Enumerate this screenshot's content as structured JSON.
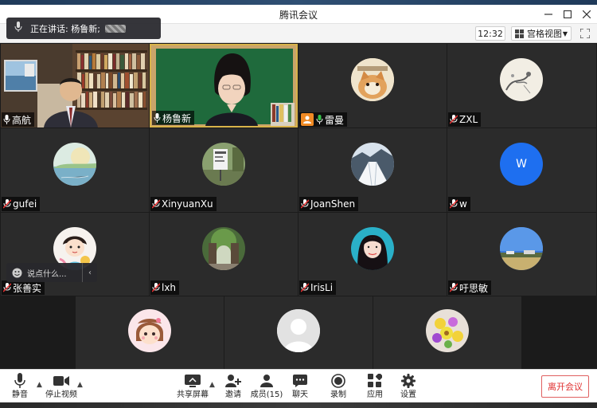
{
  "window": {
    "title": "腾讯会议"
  },
  "toolbar": {
    "clock": "12:32",
    "view_label": "宫格视图"
  },
  "speaking": {
    "label": "正在讲话: 杨鲁新;"
  },
  "participants": [
    {
      "name": "高航",
      "kind": "video-bookshelf"
    },
    {
      "name": "杨鲁新",
      "kind": "video-board"
    },
    {
      "name": "雷曼",
      "kind": "avatar-cat",
      "host": true
    },
    {
      "name": "ZXL",
      "kind": "avatar-ink"
    },
    {
      "name": "gufei",
      "kind": "avatar-paint"
    },
    {
      "name": "XinyuanXu",
      "kind": "avatar-sign"
    },
    {
      "name": "JoanShen",
      "kind": "avatar-snow"
    },
    {
      "name": "w",
      "kind": "avatar-letter",
      "letter": "W"
    },
    {
      "name": "张善实",
      "kind": "avatar-cartoon"
    },
    {
      "name": "lxh",
      "kind": "avatar-arch"
    },
    {
      "name": "IrisLi",
      "kind": "avatar-girl"
    },
    {
      "name": "吁思敏",
      "kind": "avatar-sky"
    },
    {
      "name": "",
      "kind": "avatar-doll"
    },
    {
      "name": "",
      "kind": "avatar-default"
    },
    {
      "name": "",
      "kind": "avatar-flower"
    }
  ],
  "chat": {
    "placeholder": "说点什么..."
  },
  "bottom": {
    "mute": "静音",
    "stop_video": "停止视频",
    "share": "共享屏幕",
    "invite": "邀请",
    "members": "成员(15)",
    "chat": "聊天",
    "record": "录制",
    "apps": "应用",
    "settings": "设置",
    "leave": "离开会议"
  },
  "colors": {
    "tile_bg": "#2b2b2b",
    "avatar_blue": "#1e6ff0",
    "leave_red": "#e03030",
    "host_orange": "#f08a24"
  }
}
